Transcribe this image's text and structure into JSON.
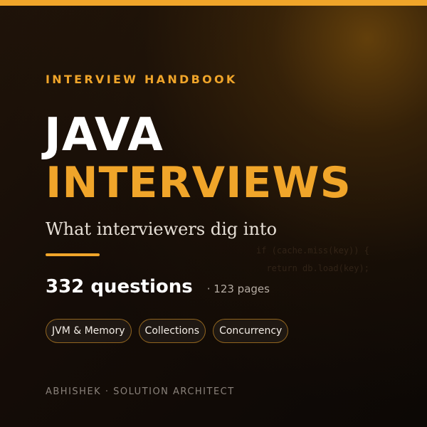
{
  "eyebrow": "INTERVIEW HANDBOOK",
  "title": {
    "line1": "JAVA",
    "line2": "INTERVIEWS"
  },
  "subtitle": "What interviewers dig into",
  "code_watermark": [
    "if (cache.miss(key)) {",
    "  return db.load(key);"
  ],
  "stats": {
    "questions": "332 questions",
    "pages": "· 123 pages"
  },
  "tags": [
    "JVM & Memory",
    "Collections",
    "Concurrency"
  ],
  "author": "ABHISHEK · SOLUTION ARCHITECT",
  "colors": {
    "accent": "#f0a52a",
    "background": "#140c07",
    "title_primary": "#ffffff"
  }
}
